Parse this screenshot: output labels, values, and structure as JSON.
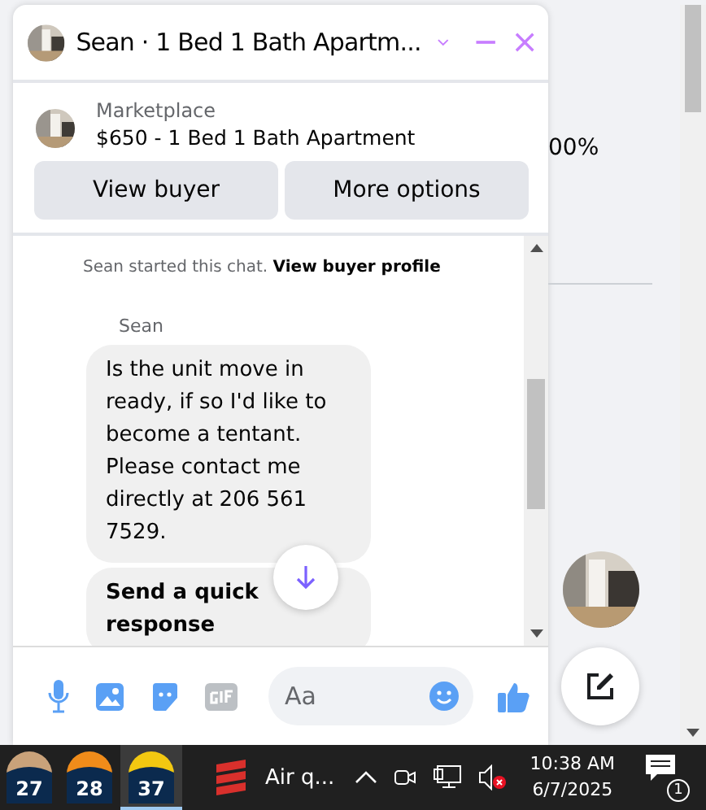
{
  "background": {
    "stat_text": "00%"
  },
  "chat": {
    "title": "Sean · 1 Bed 1 Bath Apartm...",
    "listing": {
      "source": "Marketplace",
      "title": "$650 - 1 Bed 1 Bath Apartment"
    },
    "buttons": [
      "View buyer",
      "More options"
    ],
    "notice": {
      "text": "Sean started this chat.",
      "link": "View buyer profile"
    },
    "sender": "Sean",
    "messages": [
      {
        "text": "Is the unit move in ready, if so I'd like to become a tentant. Please contact me directly at 206 561 7529.",
        "kind": "plain"
      },
      {
        "text": "Send a quick response",
        "kind": "bold"
      }
    ],
    "composer": {
      "placeholder": "Aa"
    }
  },
  "taskbar": {
    "weather": [
      {
        "temp": "27",
        "color": "#c9a27a",
        "selected": false
      },
      {
        "temp": "28",
        "color": "#f08c1a",
        "selected": false
      },
      {
        "temp": "37",
        "color": "#f2c811",
        "selected": true
      }
    ],
    "app": "Air q...",
    "time": "10:38 AM",
    "date": "6/7/2025",
    "notifications": "1"
  }
}
